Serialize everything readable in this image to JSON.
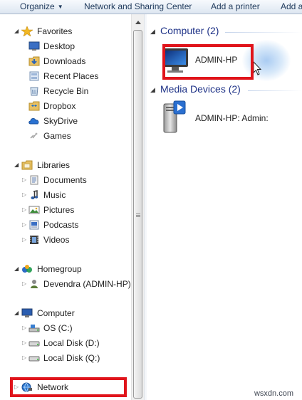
{
  "toolbar": {
    "organize": "Organize",
    "network_sharing": "Network and Sharing Center",
    "add_printer": "Add a printer",
    "add_more": "Add a"
  },
  "nav": {
    "favorites": {
      "label": "Favorites",
      "items": [
        "Desktop",
        "Downloads",
        "Recent Places",
        "Recycle Bin",
        "Dropbox",
        "SkyDrive",
        "Games"
      ]
    },
    "libraries": {
      "label": "Libraries",
      "items": [
        "Documents",
        "Music",
        "Pictures",
        "Podcasts",
        "Videos"
      ]
    },
    "homegroup": {
      "label": "Homegroup",
      "items": [
        "Devendra (ADMIN-HP)"
      ]
    },
    "computer": {
      "label": "Computer",
      "items": [
        "OS (C:)",
        "Local Disk (D:)",
        "Local Disk (Q:)"
      ]
    },
    "network": {
      "label": "Network"
    }
  },
  "content": {
    "computer_group": {
      "label": "Computer (2)",
      "item": "ADMIN-HP"
    },
    "media_group": {
      "label": "Media Devices (2)",
      "item": "ADMIN-HP: Admin:"
    }
  },
  "colors": {
    "highlight_box": "#e0141b",
    "group_header": "#1e3287",
    "toolbar_text": "#1e395b"
  },
  "watermark": "wsxdn.com"
}
